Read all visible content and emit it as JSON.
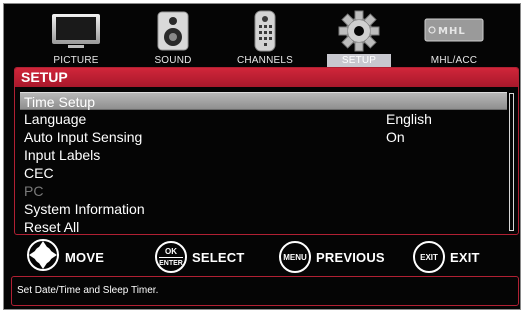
{
  "nav": {
    "items": [
      {
        "label": "PICTURE",
        "icon": "tv-icon",
        "active": false
      },
      {
        "label": "SOUND",
        "icon": "speaker-icon",
        "active": false
      },
      {
        "label": "CHANNELS",
        "icon": "remote-icon",
        "active": false
      },
      {
        "label": "SETUP",
        "icon": "gear-icon",
        "active": true
      },
      {
        "label": "MHL/ACC",
        "icon": "mhl-logo-icon",
        "active": false
      }
    ],
    "mhl_logo_text": "MHL"
  },
  "panel": {
    "title": "SETUP",
    "items": [
      {
        "label": "Time Setup",
        "value": "",
        "selected": true,
        "enabled": true
      },
      {
        "label": "Language",
        "value": "English",
        "selected": false,
        "enabled": true
      },
      {
        "label": "Auto Input Sensing",
        "value": "On",
        "selected": false,
        "enabled": true
      },
      {
        "label": "Input Labels",
        "value": "",
        "selected": false,
        "enabled": true
      },
      {
        "label": "CEC",
        "value": "",
        "selected": false,
        "enabled": true
      },
      {
        "label": "PC",
        "value": "",
        "selected": false,
        "enabled": false
      },
      {
        "label": "System Information",
        "value": "",
        "selected": false,
        "enabled": true
      },
      {
        "label": "Reset All",
        "value": "",
        "selected": false,
        "enabled": true
      }
    ]
  },
  "buttons": {
    "move": {
      "label": "MOVE",
      "icon": "dpad-icon"
    },
    "select": {
      "label": "SELECT",
      "badge_top": "OK",
      "badge_bottom": "ENTER"
    },
    "previous": {
      "label": "PREVIOUS",
      "badge": "MENU"
    },
    "exit": {
      "label": "EXIT",
      "badge": "EXIT"
    }
  },
  "status": {
    "text": "Set Date/Time and Sleep Timer."
  },
  "colors": {
    "accent": "#c21f35",
    "background": "#050505",
    "highlight": "#a8a8a8",
    "disabled_text": "#7a7a7a"
  }
}
